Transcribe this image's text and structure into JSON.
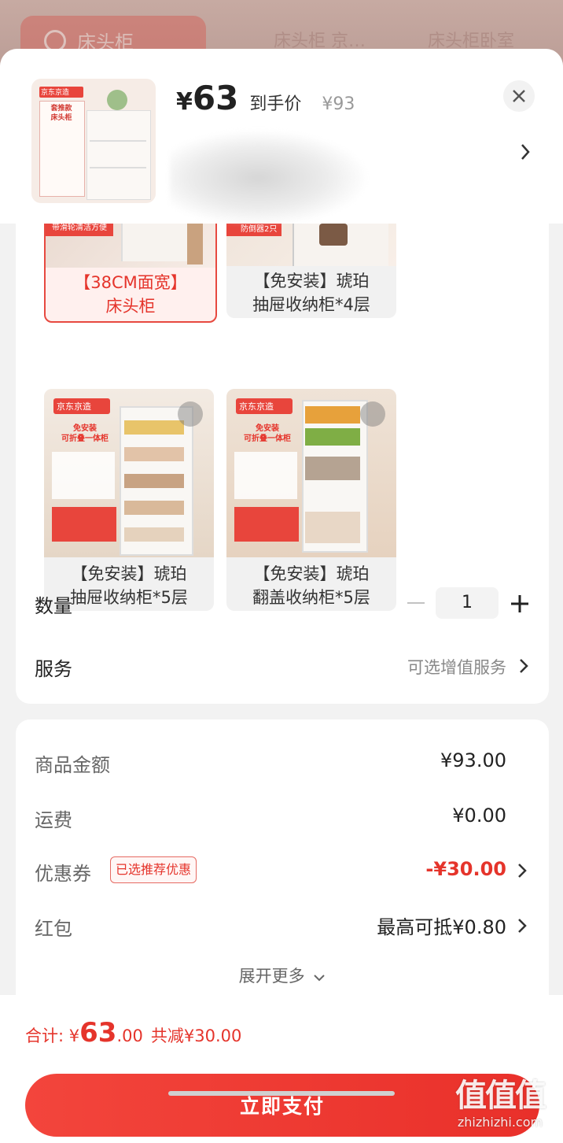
{
  "background": {
    "search_text": "床头柜",
    "tab_2": "床头柜 京…",
    "tab_3": "床头柜卧室"
  },
  "header": {
    "price_symbol": "¥",
    "price": "63",
    "price_label": "到手价",
    "original_price": "¥93",
    "thumb_brand": "京东京造",
    "thumb_badge": "套推款\n床头柜",
    "close_icon": "close-icon",
    "detail_icon": "chevron-right-icon"
  },
  "options": [
    {
      "label": "【38CM面宽】\n床头柜",
      "caption": "带滑轮清洁方便",
      "selected": true
    },
    {
      "label": "【免安装】琥珀\n抽屉收纳柜*4层",
      "caption": "防倒器2只",
      "selected": false
    },
    {
      "label": "【免安装】琥珀\n抽屉收纳柜*5层",
      "brand": "京东京造",
      "badge": "免安装\n可折叠一体柜",
      "selected": false
    },
    {
      "label": "【免安装】琥珀\n翻盖收纳柜*5层",
      "brand": "京东京造",
      "badge": "免安装\n可折叠一体柜",
      "selected": false
    }
  ],
  "quantity": {
    "label": "数量",
    "value": "1"
  },
  "service": {
    "label": "服务",
    "value": "可选增值服务"
  },
  "fees": {
    "goods_label": "商品金额",
    "goods_value": "¥93.00",
    "shipping_label": "运费",
    "shipping_value": "¥0.00",
    "coupon_label": "优惠券",
    "coupon_tag": "已选推荐优惠",
    "coupon_value": "-¥30.00",
    "redpacket_label": "红包",
    "redpacket_value": "最高可抵¥0.80",
    "more": "展开更多"
  },
  "footer": {
    "total_prefix": "合计: ¥",
    "total_int": "63",
    "total_dec": ".00",
    "saved": "共减¥30.00",
    "pay_button": "立即支付"
  },
  "watermark": {
    "main": "值值值",
    "site": "zhizhizhi.com"
  },
  "colors": {
    "accent": "#e5342b",
    "button": "#ef3b33"
  }
}
